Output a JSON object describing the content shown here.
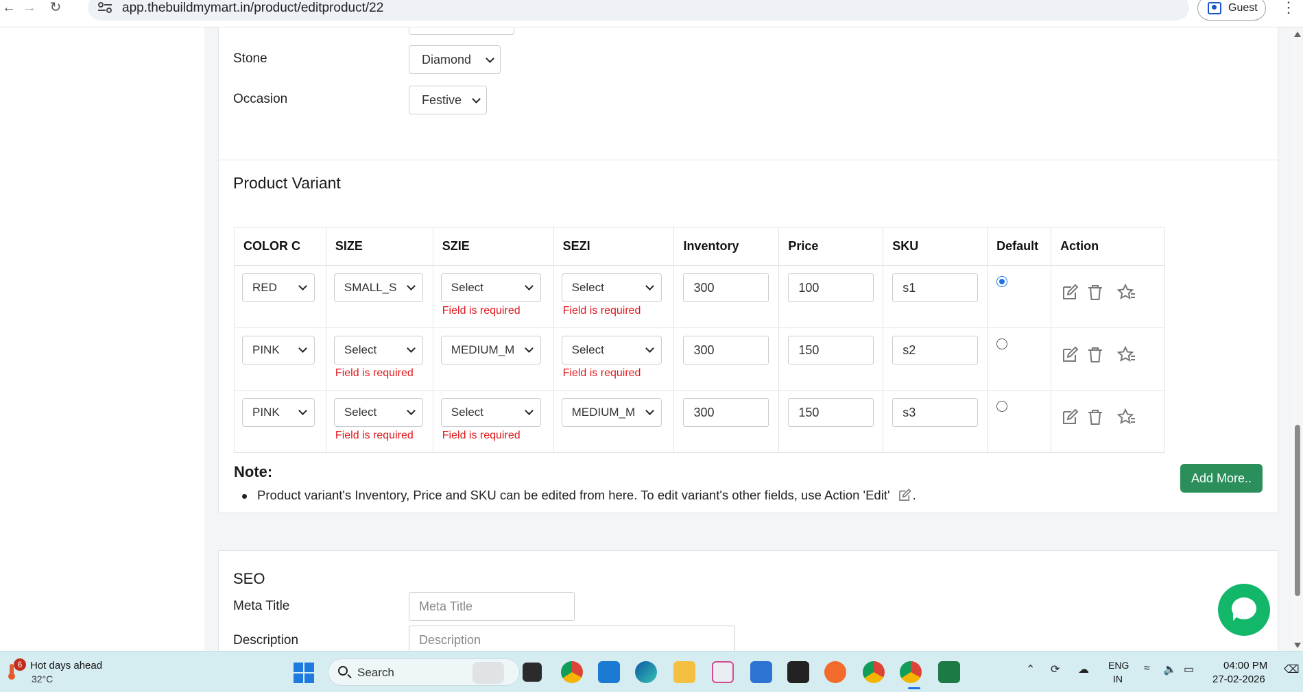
{
  "browser": {
    "url": "app.thebuildmymart.in/product/editproduct/22",
    "profile_label": "Guest"
  },
  "attributes": {
    "stone": {
      "label": "Stone",
      "value": "Diamond"
    },
    "occasion": {
      "label": "Occasion",
      "value": "Festive"
    }
  },
  "variant": {
    "title": "Product Variant",
    "headers": [
      "COLOR C",
      "SIZE",
      "SZIE",
      "SEZI",
      "Inventory",
      "Price",
      "SKU",
      "Default",
      "Action"
    ],
    "error_text": "Field is required",
    "rows": [
      {
        "color": "RED",
        "size": "SMALL_S",
        "szie": "Select",
        "sezi": "Select",
        "inventory": "300",
        "price": "100",
        "sku": "s1",
        "default": true
      },
      {
        "color": "PINK",
        "size": "Select",
        "szie": "MEDIUM_M",
        "sezi": "Select",
        "inventory": "300",
        "price": "150",
        "sku": "s2",
        "default": false
      },
      {
        "color": "PINK",
        "size": "Select",
        "szie": "Select",
        "sezi": "MEDIUM_M",
        "inventory": "300",
        "price": "150",
        "sku": "s3",
        "default": false
      }
    ],
    "note_title": "Note:",
    "note_text": "Product variant's Inventory, Price and SKU can be edited from here. To edit variant's other fields, use Action 'Edit'",
    "note_suffix": ".",
    "add_more_label": "Add More.."
  },
  "seo": {
    "title": "SEO",
    "meta_title_label": "Meta Title",
    "meta_title_placeholder": "Meta Title",
    "description_label": "Description",
    "description_placeholder": "Description"
  },
  "taskbar": {
    "weather_badge": "6",
    "weather_title": "Hot days ahead",
    "weather_temp": "32°C",
    "search_label": "Search",
    "lang_line1": "ENG",
    "lang_line2": "IN",
    "time": "04:00 PM",
    "date": "27-02-2026"
  },
  "colors": {
    "accent_green": "#2a8f5a",
    "error_red": "#e0171c",
    "chat_green": "#12b76a",
    "radio_blue": "#1a73e8"
  },
  "icons": [
    "back-icon",
    "forward-icon",
    "reload-icon",
    "site-settings-icon",
    "profile-icon",
    "menu-icon",
    "edit-icon",
    "delete-icon",
    "favorite-icon",
    "chat-icon",
    "windows-start-icon",
    "search-icon"
  ]
}
